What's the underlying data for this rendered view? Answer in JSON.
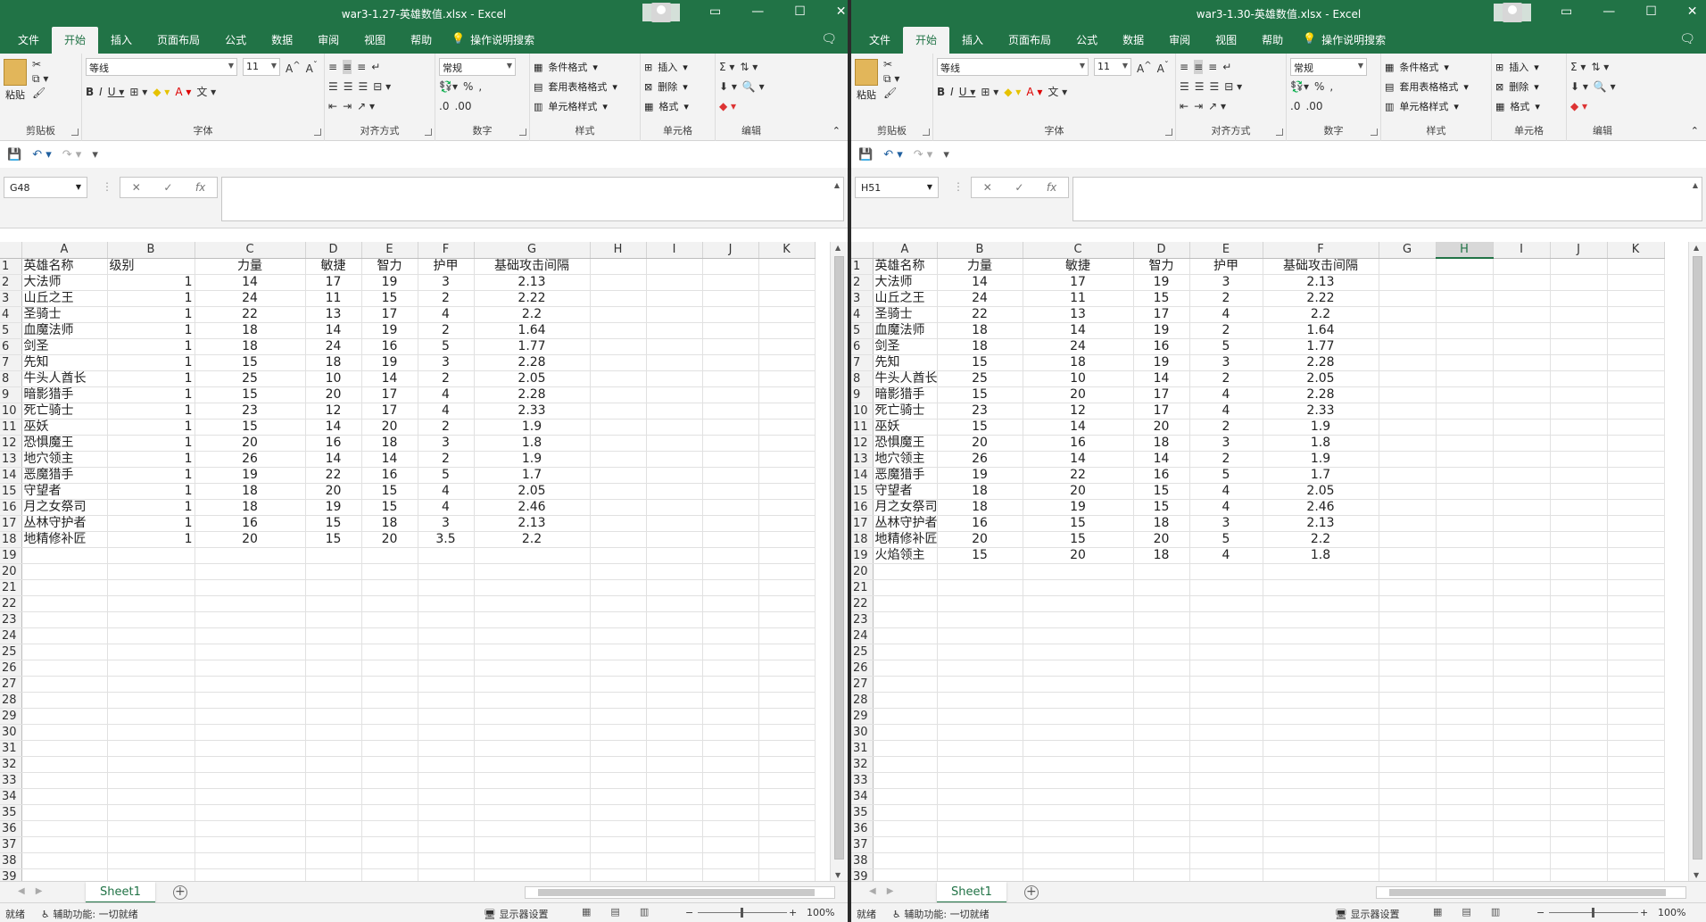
{
  "left": {
    "title": "war3-1.27-英雄数值.xlsx  -  Excel",
    "namebox": "G48",
    "columns": [
      "A",
      "B",
      "C",
      "D",
      "E",
      "F",
      "G",
      "H",
      "I",
      "J",
      "K"
    ],
    "header": [
      "英雄名称",
      "级别",
      "力量",
      "敏捷",
      "智力",
      "护甲",
      "基础攻击间隔"
    ],
    "rows": [
      [
        "大法师",
        "1",
        "14",
        "17",
        "19",
        "3",
        "2.13"
      ],
      [
        "山丘之王",
        "1",
        "24",
        "11",
        "15",
        "2",
        "2.22"
      ],
      [
        "圣骑士",
        "1",
        "22",
        "13",
        "17",
        "4",
        "2.2"
      ],
      [
        "血魔法师",
        "1",
        "18",
        "14",
        "19",
        "2",
        "1.64"
      ],
      [
        "剑圣",
        "1",
        "18",
        "24",
        "16",
        "5",
        "1.77"
      ],
      [
        "先知",
        "1",
        "15",
        "18",
        "19",
        "3",
        "2.28"
      ],
      [
        "牛头人酋长",
        "1",
        "25",
        "10",
        "14",
        "2",
        "2.05"
      ],
      [
        "暗影猎手",
        "1",
        "15",
        "20",
        "17",
        "4",
        "2.28"
      ],
      [
        "死亡骑士",
        "1",
        "23",
        "12",
        "17",
        "4",
        "2.33"
      ],
      [
        "巫妖",
        "1",
        "15",
        "14",
        "20",
        "2",
        "1.9"
      ],
      [
        "恐惧魔王",
        "1",
        "20",
        "16",
        "18",
        "3",
        "1.8"
      ],
      [
        "地穴领主",
        "1",
        "26",
        "14",
        "14",
        "2",
        "1.9"
      ],
      [
        "恶魔猎手",
        "1",
        "19",
        "22",
        "16",
        "5",
        "1.7"
      ],
      [
        "守望者",
        "1",
        "18",
        "20",
        "15",
        "4",
        "2.05"
      ],
      [
        "月之女祭司",
        "1",
        "18",
        "19",
        "15",
        "4",
        "2.46"
      ],
      [
        "丛林守护者",
        "1",
        "16",
        "15",
        "18",
        "3",
        "2.13"
      ],
      [
        "地精修补匠",
        "1",
        "20",
        "15",
        "20",
        "3.5",
        "2.2"
      ]
    ]
  },
  "right": {
    "title": "war3-1.30-英雄数值.xlsx  -  Excel",
    "namebox": "H51",
    "columns": [
      "A",
      "B",
      "C",
      "D",
      "E",
      "F",
      "G",
      "H",
      "I",
      "J",
      "K"
    ],
    "header": [
      "英雄名称",
      "力量",
      "敏捷",
      "智力",
      "护甲",
      "基础攻击间隔"
    ],
    "rows": [
      [
        "大法师",
        "14",
        "17",
        "19",
        "3",
        "2.13"
      ],
      [
        "山丘之王",
        "24",
        "11",
        "15",
        "2",
        "2.22"
      ],
      [
        "圣骑士",
        "22",
        "13",
        "17",
        "4",
        "2.2"
      ],
      [
        "血魔法师",
        "18",
        "14",
        "19",
        "2",
        "1.64"
      ],
      [
        "剑圣",
        "18",
        "24",
        "16",
        "5",
        "1.77"
      ],
      [
        "先知",
        "15",
        "18",
        "19",
        "3",
        "2.28"
      ],
      [
        "牛头人酋长",
        "25",
        "10",
        "14",
        "2",
        "2.05"
      ],
      [
        "暗影猎手",
        "15",
        "20",
        "17",
        "4",
        "2.28"
      ],
      [
        "死亡骑士",
        "23",
        "12",
        "17",
        "4",
        "2.33"
      ],
      [
        "巫妖",
        "15",
        "14",
        "20",
        "2",
        "1.9"
      ],
      [
        "恐惧魔王",
        "20",
        "16",
        "18",
        "3",
        "1.8"
      ],
      [
        "地穴领主",
        "26",
        "14",
        "14",
        "2",
        "1.9"
      ],
      [
        "恶魔猎手",
        "19",
        "22",
        "16",
        "5",
        "1.7"
      ],
      [
        "守望者",
        "18",
        "20",
        "15",
        "4",
        "2.05"
      ],
      [
        "月之女祭司",
        "18",
        "19",
        "15",
        "4",
        "2.46"
      ],
      [
        "丛林守护者",
        "16",
        "15",
        "18",
        "3",
        "2.13"
      ],
      [
        "地精修补匠",
        "20",
        "15",
        "20",
        "5",
        "2.2"
      ],
      [
        "火焰领主",
        "15",
        "20",
        "18",
        "4",
        "1.8"
      ]
    ]
  },
  "tabs": [
    "文件",
    "开始",
    "插入",
    "页面布局",
    "公式",
    "数据",
    "审阅",
    "视图",
    "帮助"
  ],
  "tell_me": "操作说明搜索",
  "ribbon": {
    "paste": "粘贴",
    "clipboard": "剪贴板",
    "font_name": "等线",
    "font_size": "11",
    "font": "字体",
    "align": "对齐方式",
    "number_format": "常规",
    "number": "数字",
    "cond_format": "条件格式",
    "table_format": "套用表格格式",
    "cell_style": "单元格样式",
    "styles": "样式",
    "insert": "插入",
    "delete": "删除",
    "format": "格式",
    "cells": "单元格",
    "editing": "编辑"
  },
  "sheet_tab": "Sheet1",
  "status": {
    "ready": "就绪",
    "accessibility": "辅助功能: 一切就绪",
    "display": "显示器设置",
    "zoom": "100%"
  },
  "row_count": 39
}
